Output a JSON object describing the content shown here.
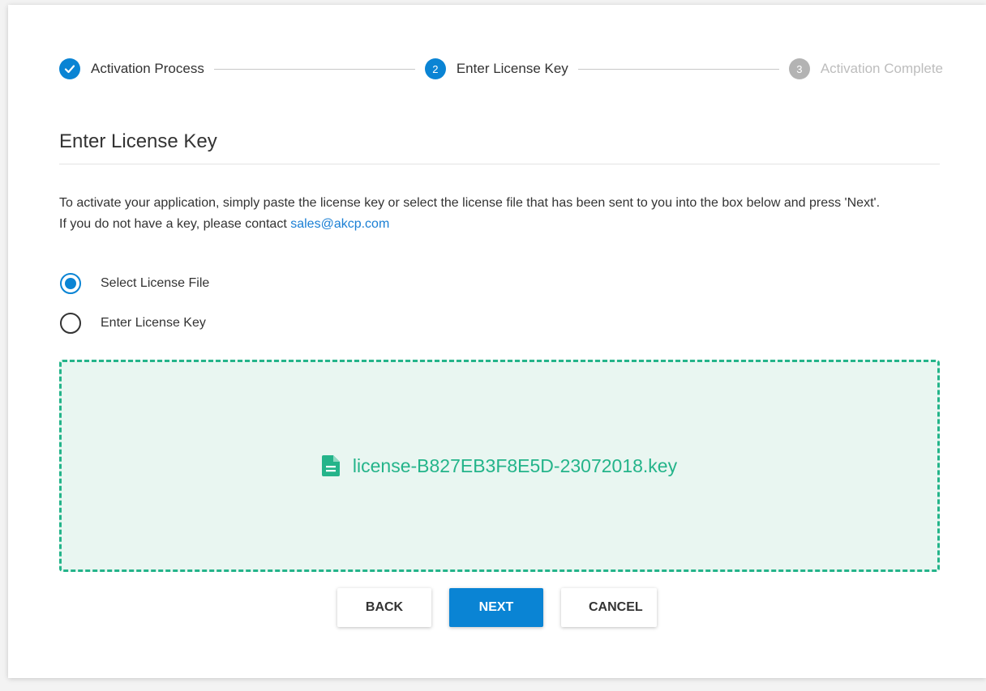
{
  "stepper": {
    "steps": [
      {
        "number": "",
        "label": "Activation Process",
        "state": "done"
      },
      {
        "number": "2",
        "label": "Enter License Key",
        "state": "active"
      },
      {
        "number": "3",
        "label": "Activation Complete",
        "state": "pending"
      }
    ]
  },
  "page": {
    "title": "Enter License Key",
    "instructions_line1": "To activate your application, simply paste the license key or select the license file that has been sent to you into the box below and press 'Next'.",
    "instructions_line2_prefix": "If you do not have a key, please contact ",
    "contact_email": "sales@akcp.com"
  },
  "options": {
    "selected": "Select License File",
    "items": [
      {
        "label": "Select License File",
        "checked": true
      },
      {
        "label": "Enter License Key",
        "checked": false
      }
    ]
  },
  "dropzone": {
    "file_name": "license-B827EB3F8E5D-23072018.key",
    "icon": "file-document-icon"
  },
  "actions": {
    "back_label": "BACK",
    "next_label": "NEXT",
    "cancel_label": "CANCEL"
  },
  "colors": {
    "accent": "#0a84d4",
    "success": "#24b48a",
    "dropzone_bg": "#e9f6f1",
    "pending": "#b3b3b3"
  }
}
